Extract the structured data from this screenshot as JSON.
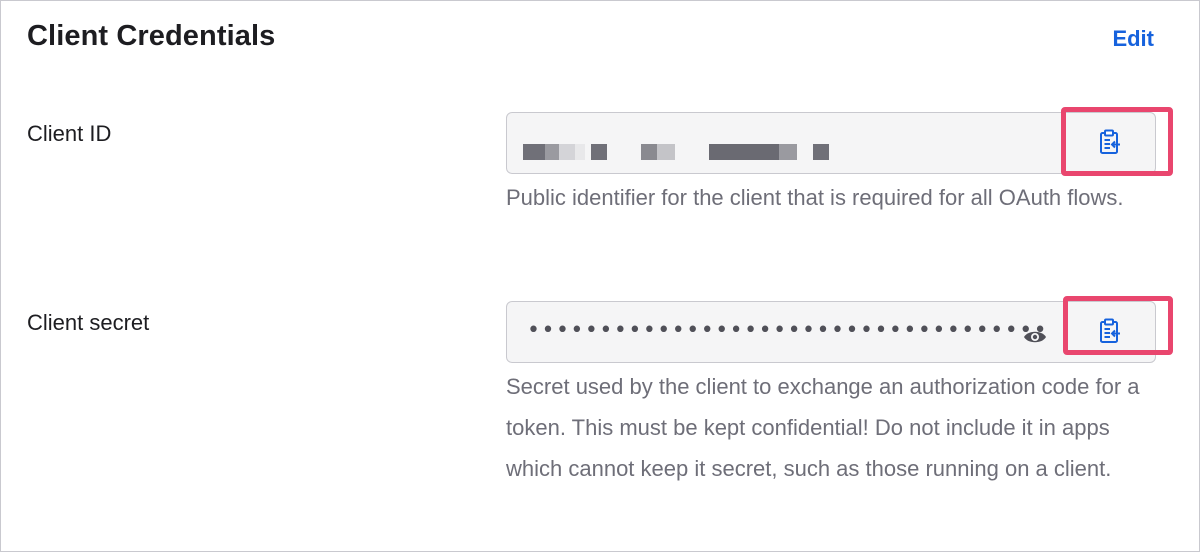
{
  "header": {
    "title": "Client Credentials",
    "edit_label": "Edit"
  },
  "client_id": {
    "label": "Client ID",
    "value": "",
    "value_redacted": true,
    "help": "Public identifier for the client that is required for all OAuth flows.",
    "copy_icon": "clipboard-copy-icon"
  },
  "client_secret": {
    "label": "Client secret",
    "masked_value": "••••••••••••••••••••••••••••••••••••",
    "help": "Secret used by the client to exchange an authorization code for a token. This must be kept confidential! Do not include it in apps which cannot keep it secret, such as those running on a client.",
    "reveal_icon": "eye-icon",
    "copy_icon": "clipboard-copy-icon"
  },
  "colors": {
    "accent": "#1662dd",
    "highlight": "#e9466e",
    "text": "#1d1d21",
    "help_text": "#6e6e78",
    "field_bg": "#f5f5f6"
  }
}
